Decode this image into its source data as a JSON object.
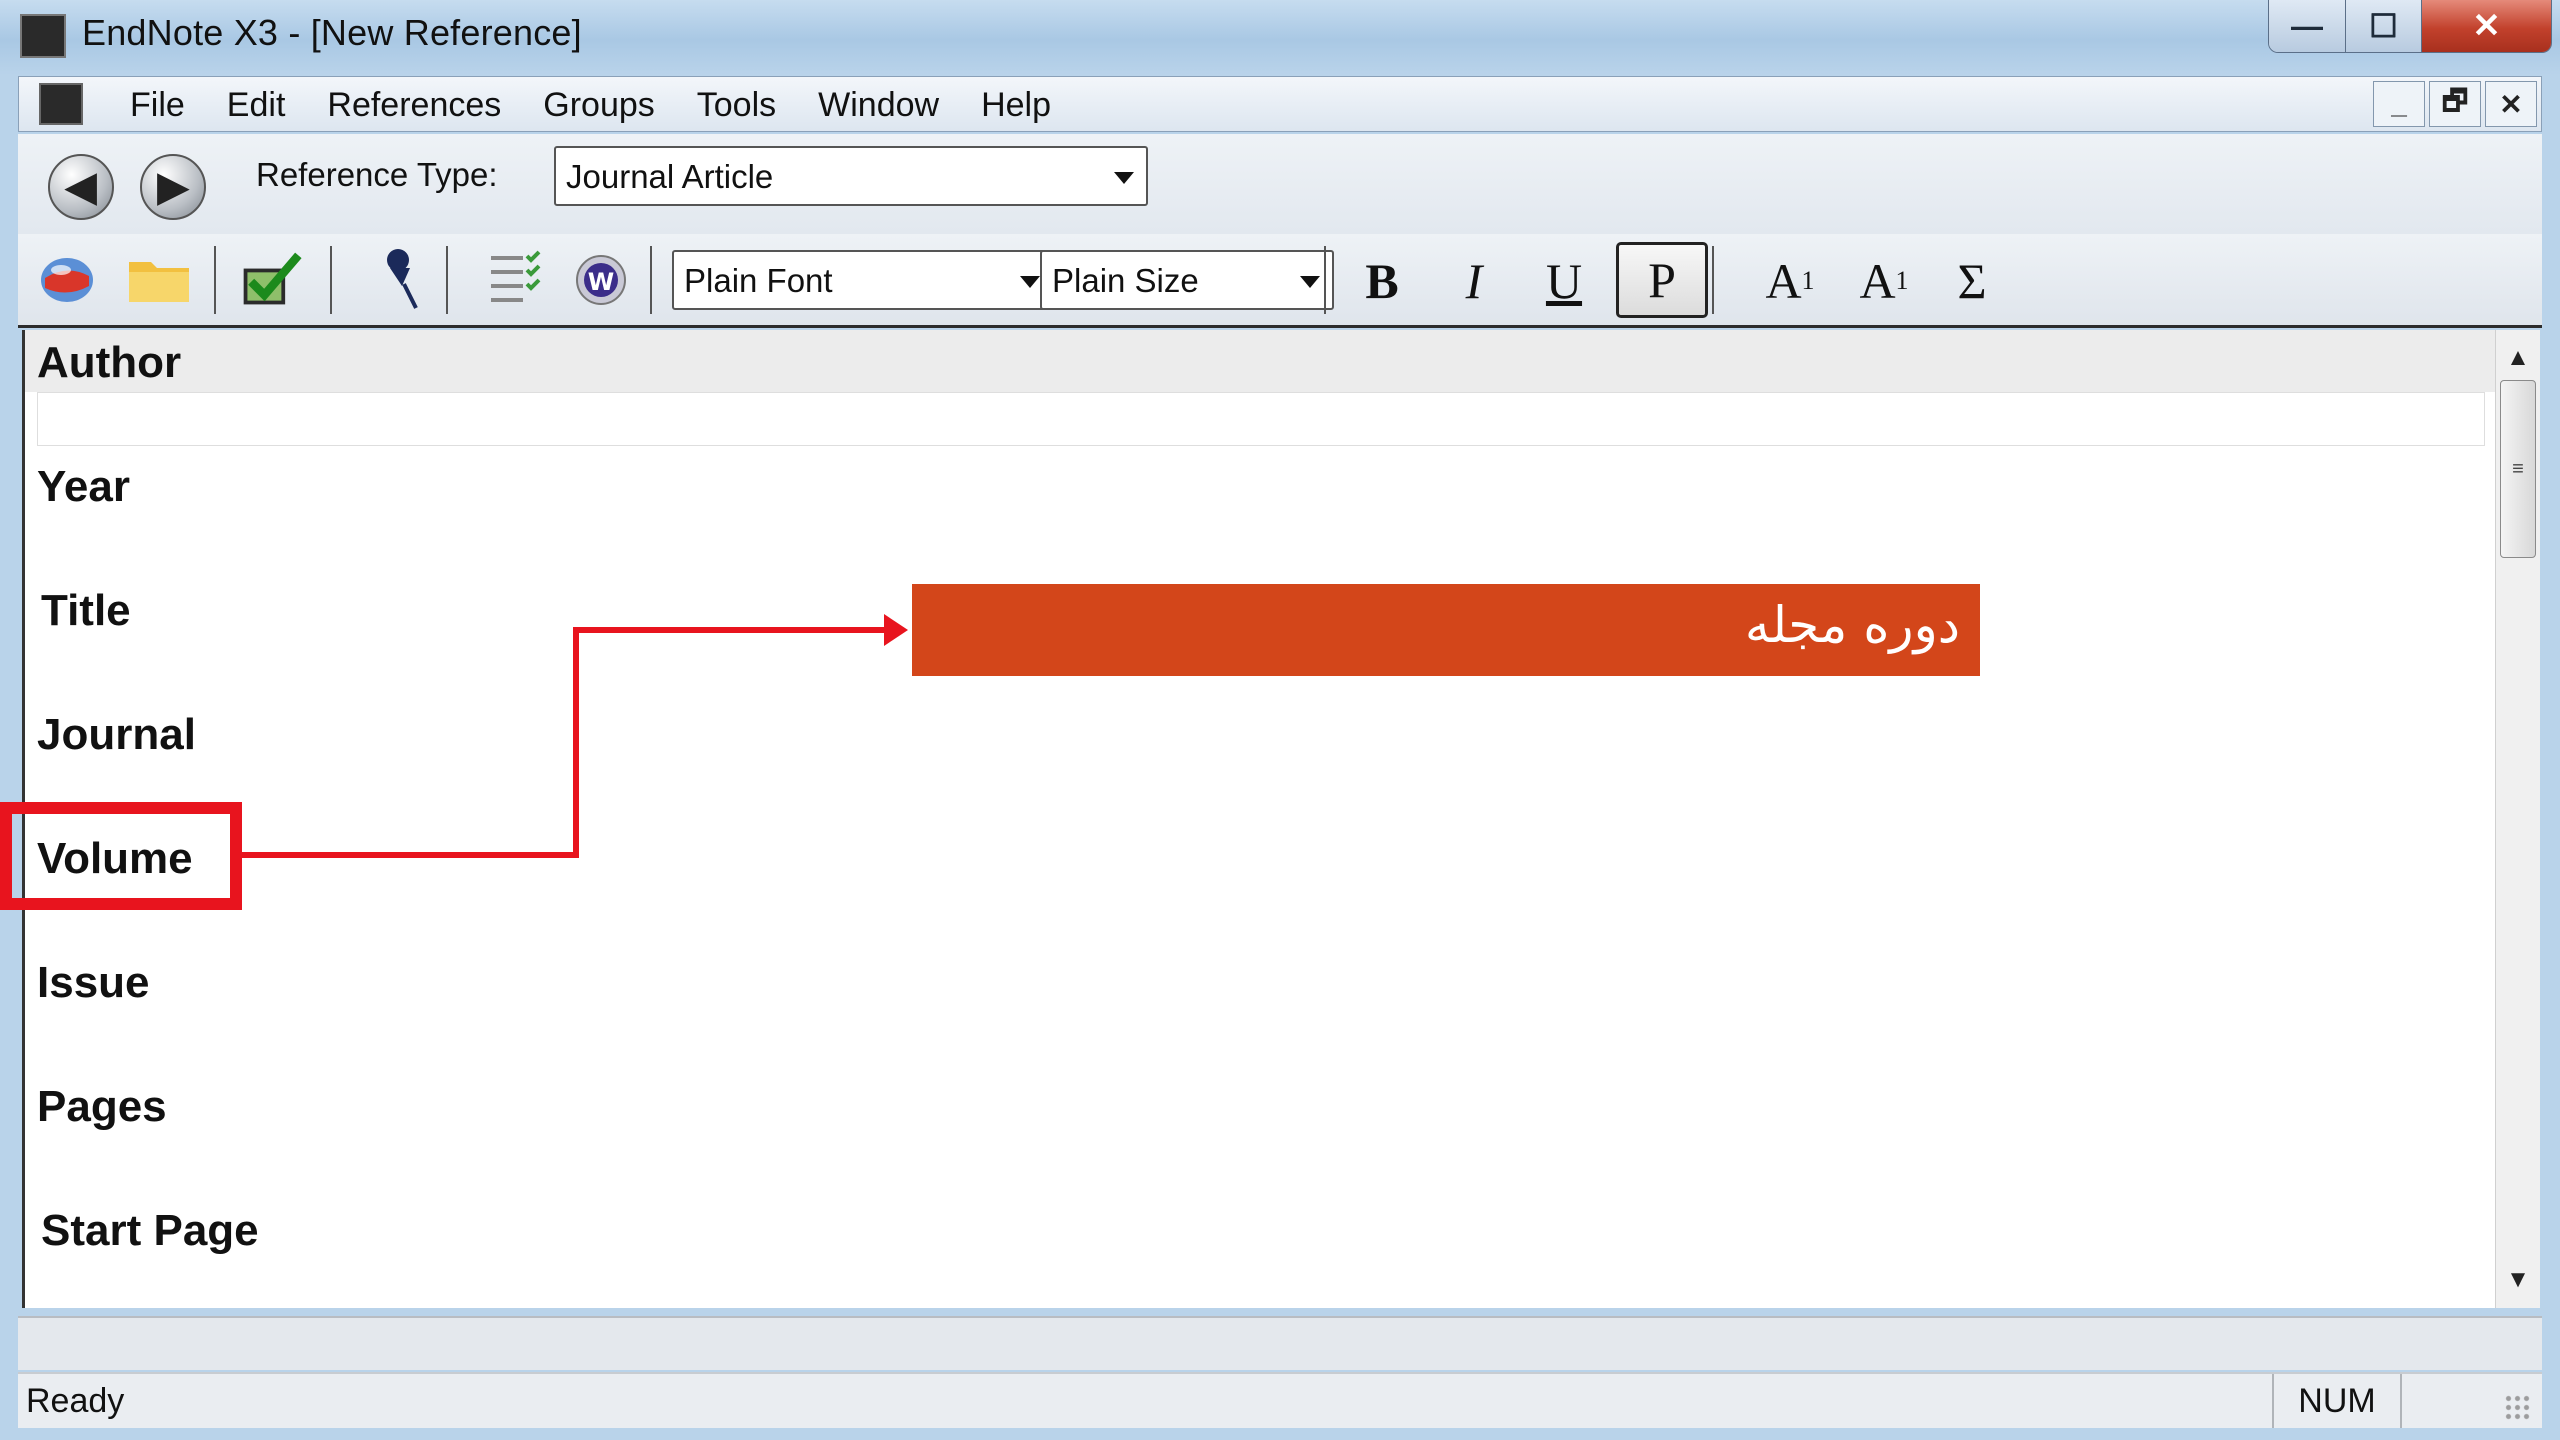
{
  "window": {
    "title": "EndNote X3 - [New Reference]",
    "controls": {
      "minimize": "—",
      "maximize": "☐",
      "close": "✕"
    }
  },
  "menubar": {
    "items": [
      "File",
      "Edit",
      "References",
      "Groups",
      "Tools",
      "Window",
      "Help"
    ],
    "mdi_controls": {
      "minimize": "_",
      "restore": "🗗",
      "close": "✕"
    }
  },
  "toolbar": {
    "back_icon": "arrow-left-icon",
    "forward_icon": "arrow-right-icon",
    "reference_type_label": "Reference Type:",
    "reference_type_value": "Journal Article",
    "font_value": "Plain Font",
    "size_value": "Plain Size",
    "format_buttons": {
      "bold": "B",
      "italic": "I",
      "underline": "U",
      "plain": "P",
      "superscript": "A",
      "superscript_mark": "1",
      "subscript": "A",
      "subscript_mark": "1",
      "symbol": "Σ"
    },
    "icons": [
      "globe-icon",
      "folder-icon",
      "checkmark-icon",
      "pushpin-icon",
      "checklist-icon",
      "word-icon"
    ]
  },
  "editor": {
    "fields": [
      "Author",
      "Year",
      "Title",
      "Journal",
      "Volume",
      "Issue",
      "Pages",
      "Start Page"
    ]
  },
  "annotation": {
    "label": "دوره مجله",
    "highlight_color": "#e8141e",
    "banner_color": "#d3461a"
  },
  "status": {
    "text": "Ready",
    "num": "NUM"
  }
}
